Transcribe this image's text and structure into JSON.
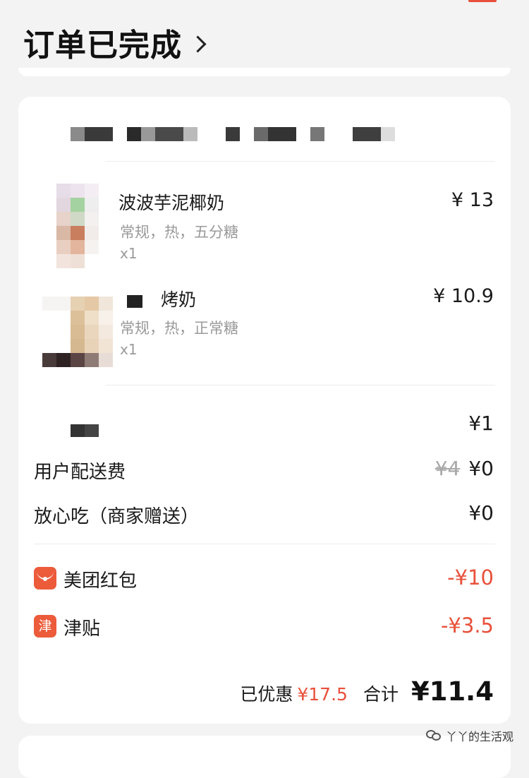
{
  "header": {
    "status_title": "订单已完成"
  },
  "items": [
    {
      "name": "波波芋泥椰奶",
      "spec": "常规，热，五分糖",
      "qty": "x1",
      "price": "¥ 13"
    },
    {
      "name": "烤奶",
      "spec": "常规，热，正常糖",
      "qty": "x1",
      "price": "¥ 10.9"
    }
  ],
  "fees": {
    "packaging_value": "¥1",
    "delivery_label": "用户配送费",
    "delivery_original": "¥4",
    "delivery_value": "¥0",
    "insurance_label": "放心吃（商家赠送）",
    "insurance_value": "¥0"
  },
  "discounts": [
    {
      "icon": "red-envelope-icon",
      "label": "美团红包",
      "value": "-¥10"
    },
    {
      "icon": "jin-tie-icon",
      "icon_text": "津",
      "label": "津贴",
      "value": "-¥3.5"
    }
  ],
  "total": {
    "saved_label": "已优惠",
    "saved_value": "¥17.5",
    "total_label": "合计",
    "total_value": "¥11.4"
  },
  "watermark": {
    "text": "丫丫的生活观"
  },
  "colors": {
    "accent_red": "#e8503b",
    "muted_gray": "#9a9a9a",
    "background": "#f3f3f3"
  }
}
